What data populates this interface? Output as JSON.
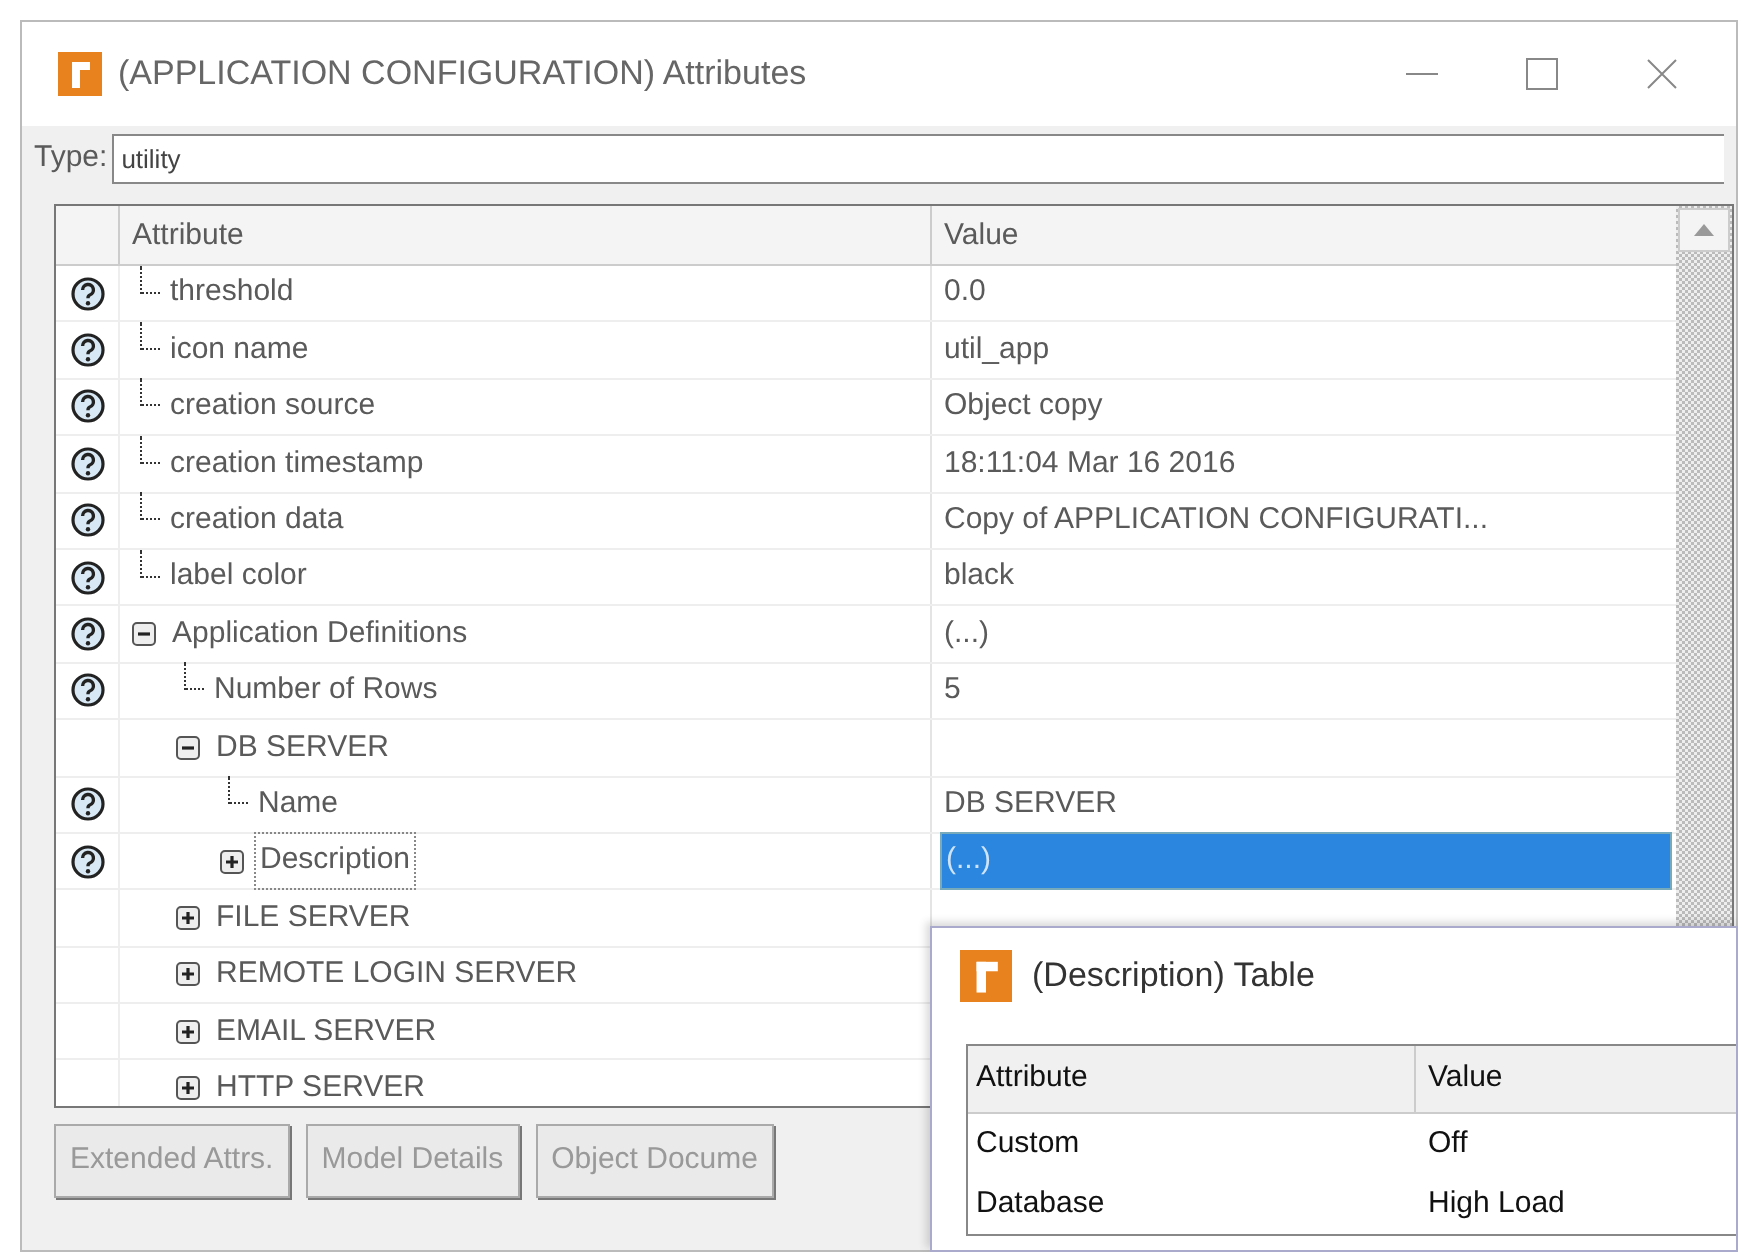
{
  "window": {
    "title": "(APPLICATION CONFIGURATION) Attributes"
  },
  "type_field": {
    "label": "Type:",
    "value": "utility"
  },
  "grid": {
    "columns": [
      "Attribute",
      "Value"
    ],
    "rows": [
      {
        "name": "threshold",
        "value": "0.0",
        "help": true,
        "selected": false
      },
      {
        "name": "icon name",
        "value": "util_app",
        "help": true,
        "selected": false
      },
      {
        "name": "creation source",
        "value": "Object copy",
        "help": true,
        "selected": false
      },
      {
        "name": "creation timestamp",
        "value": "18:11:04 Mar 16 2016",
        "help": true,
        "selected": false
      },
      {
        "name": "creation data",
        "value": "Copy of APPLICATION CONFIGURATI...",
        "help": true,
        "selected": false
      },
      {
        "name": "label color",
        "value": "black",
        "help": true,
        "selected": false
      },
      {
        "name": "Application Definitions",
        "value": "(...)",
        "help": true,
        "selected": false,
        "expanded": true,
        "children": [
          {
            "name": "Number of Rows",
            "value": "5",
            "help": true,
            "selected": false
          },
          {
            "name": "DB SERVER",
            "help": false,
            "selected": false,
            "expanded": true,
            "children": [
              {
                "name": "Name",
                "value": "DB SERVER",
                "help": true,
                "selected": false
              },
              {
                "name": "Description",
                "value": "(...)",
                "help": true,
                "selected": true,
                "expanded": false
              }
            ]
          },
          {
            "name": "FILE SERVER",
            "help": false,
            "selected": false,
            "expanded": false
          },
          {
            "name": "REMOTE LOGIN SERVER",
            "help": false,
            "selected": false,
            "expanded": false
          },
          {
            "name": "EMAIL SERVER",
            "help": false,
            "selected": false,
            "expanded": false
          },
          {
            "name": "HTTP SERVER",
            "help": false,
            "selected": false,
            "expanded": false
          }
        ]
      }
    ]
  },
  "buttons": [
    {
      "label": "Extended Attrs.",
      "disabled": true
    },
    {
      "label": "Model Details",
      "disabled": true
    },
    {
      "label": "Object Docume",
      "disabled": true
    }
  ],
  "popup": {
    "title": "(Description) Table",
    "columns": [
      "Attribute",
      "Value"
    ],
    "rows": [
      {
        "attribute": "Custom",
        "value": "Off"
      },
      {
        "attribute": "Database",
        "value": "High Load"
      }
    ]
  }
}
